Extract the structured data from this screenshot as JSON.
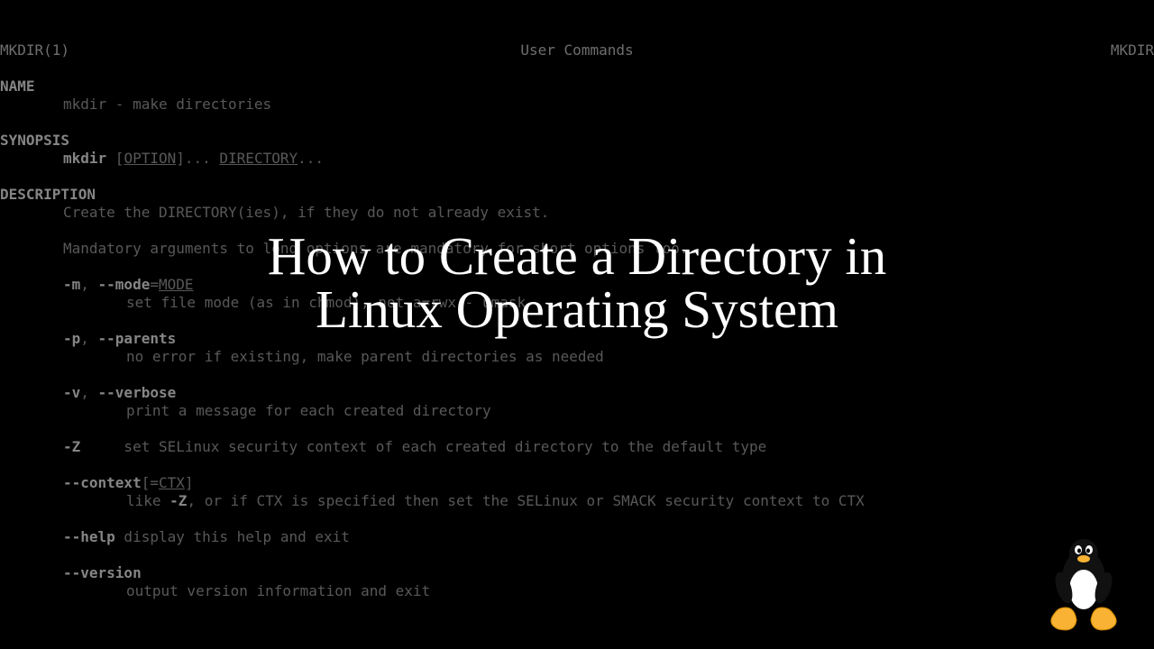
{
  "header": {
    "left": "MKDIR(1)",
    "center": "User Commands",
    "right": "MKDIR"
  },
  "name": {
    "heading": "NAME",
    "text": "mkdir - make directories"
  },
  "synopsis": {
    "heading": "SYNOPSIS",
    "cmd": "mkdir",
    "lbracket": " [",
    "option": "OPTION",
    "rbracket": "]... ",
    "directory": "DIRECTORY",
    "ellipsis": "..."
  },
  "description": {
    "heading": "DESCRIPTION",
    "line1": "Create the DIRECTORY(ies), if they do not already exist.",
    "line2": "Mandatory arguments to long options are mandatory for short options too."
  },
  "options": {
    "mode": {
      "flag": "-m",
      "sep": ", ",
      "long": "--mode",
      "eq": "=",
      "arg": "MODE",
      "desc": "set file mode (as in chmod), not a=rwx - umask"
    },
    "parents": {
      "flag": "-p",
      "sep": ", ",
      "long": "--parents",
      "desc": "no error if existing, make parent directories as needed"
    },
    "verbose": {
      "flag": "-v",
      "sep": ", ",
      "long": "--verbose",
      "desc": "print a message for each created directory"
    },
    "z": {
      "flag": "-Z",
      "desc": "     set SELinux security context of each created directory to the default type"
    },
    "context": {
      "long": "--context",
      "lbracket": "[=",
      "arg": "CTX",
      "rbracket": "]",
      "desc_pre": "like ",
      "desc_bold": "-Z",
      "desc_post": ", or if CTX is specified then set the SELinux or SMACK security context to CTX"
    },
    "help": {
      "long": "--help",
      "desc": " display this help and exit"
    },
    "version": {
      "long": "--version",
      "desc": "output version information and exit"
    }
  },
  "overlay": {
    "title_line1": "How to Create a Directory in",
    "title_line2": "Linux Operating System"
  }
}
